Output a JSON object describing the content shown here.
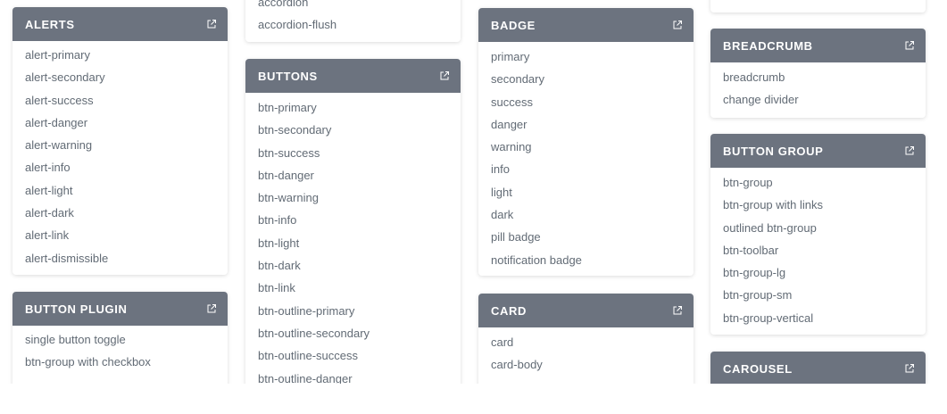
{
  "colors": {
    "header_bg": "#6c737f",
    "header_text": "#ffffff",
    "item_text": "#626b75"
  },
  "alerts": {
    "title": "ALERTS",
    "items": [
      "alert-primary",
      "alert-secondary",
      "alert-success",
      "alert-danger",
      "alert-warning",
      "alert-info",
      "alert-light",
      "alert-dark",
      "alert-link",
      "alert-dismissible"
    ]
  },
  "button_plugin": {
    "title": "BUTTON PLUGIN",
    "items": [
      "single button toggle",
      "btn-group with checkbox"
    ]
  },
  "accordion": {
    "items": [
      "accordion",
      "accordion-flush"
    ]
  },
  "buttons": {
    "title": "BUTTONS",
    "items": [
      "btn-primary",
      "btn-secondary",
      "btn-success",
      "btn-danger",
      "btn-warning",
      "btn-info",
      "btn-light",
      "btn-dark",
      "btn-link",
      "btn-outline-primary",
      "btn-outline-secondary",
      "btn-outline-success",
      "btn-outline-danger"
    ]
  },
  "badge": {
    "title": "BADGE",
    "items": [
      "primary",
      "secondary",
      "success",
      "danger",
      "warning",
      "info",
      "light",
      "dark",
      "pill badge",
      "notification badge"
    ]
  },
  "card": {
    "title": "CARD",
    "items": [
      "card",
      "card-body"
    ]
  },
  "breadcrumb": {
    "title": "BREADCRUMB",
    "items": [
      "breadcrumb",
      "change divider"
    ]
  },
  "button_group": {
    "title": "BUTTON GROUP",
    "items": [
      "btn-group",
      "btn-group with links",
      "outlined btn-group",
      "btn-toolbar",
      "btn-group-lg",
      "btn-group-sm",
      "btn-group-vertical"
    ]
  },
  "carousel": {
    "title": "CAROUSEL"
  }
}
